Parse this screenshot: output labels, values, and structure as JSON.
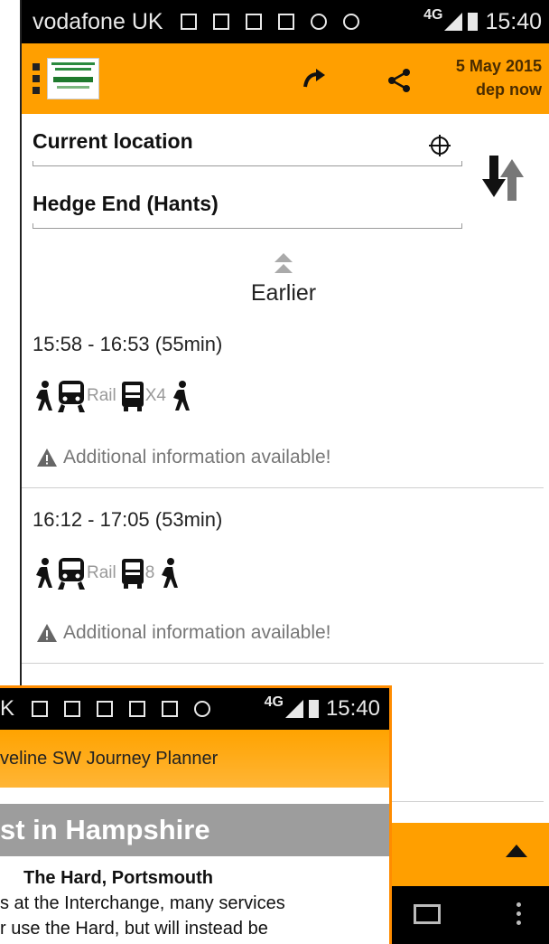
{
  "status_bar": {
    "carrier": "vodafone UK",
    "network": "4G",
    "time": "15:40"
  },
  "app_bar": {
    "date": "5 May 2015",
    "departure": "dep now",
    "colors": {
      "accent": "#ff9f00"
    }
  },
  "from_field": {
    "value": "Current location"
  },
  "to_field": {
    "value": "Hedge End (Hants)"
  },
  "earlier_label": "Earlier",
  "journeys": [
    {
      "time": "15:58 - 16:53 (55min)",
      "modes": [
        "walk",
        "Rail",
        "X4",
        "walk"
      ],
      "info": "Additional information available!"
    },
    {
      "time": "16:12 - 17:05 (53min)",
      "modes": [
        "walk",
        "Rail",
        "8",
        "walk"
      ],
      "info": "Additional information available!"
    }
  ],
  "overlay": {
    "status_carrier": "K",
    "status_network": "4G",
    "status_time": "15:40",
    "title": "veline SW Journey Planner",
    "heading": "st in Hampshire",
    "bold_line": "The Hard, Portsmouth",
    "body_line1": "s at the Interchange, many services",
    "body_line2": "r use the Hard, but will instead be"
  }
}
